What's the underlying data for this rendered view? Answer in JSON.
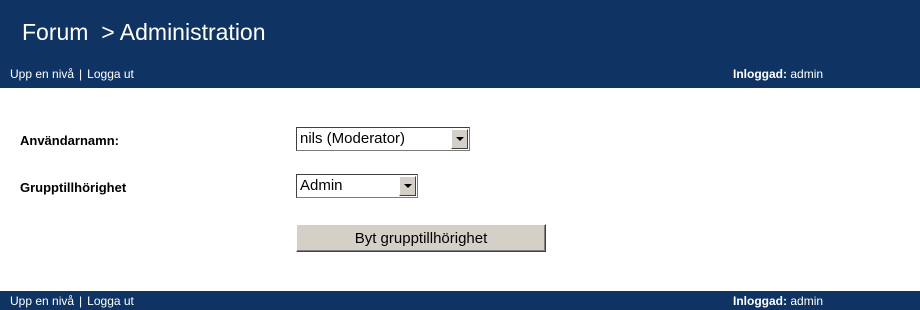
{
  "header": {
    "title": "Forum  > Administration",
    "nav": {
      "up_label": "Upp en nivå",
      "separator": "|",
      "logout_label": "Logga ut"
    },
    "login": {
      "label": "Inloggad:",
      "user": "admin"
    }
  },
  "form": {
    "username": {
      "label": "Användarnamn:",
      "selected": "nils (Moderator)"
    },
    "group": {
      "label": "Grupptillhörighet",
      "selected": "Admin"
    },
    "submit_label": "Byt grupptillhörighet"
  },
  "footer": {
    "nav": {
      "up_label": "Upp en nivå",
      "separator": "|",
      "logout_label": "Logga ut"
    },
    "login": {
      "label": "Inloggad:",
      "user": "admin"
    }
  },
  "colors": {
    "bar": "#0f3463",
    "button": "#d4d0c8"
  }
}
